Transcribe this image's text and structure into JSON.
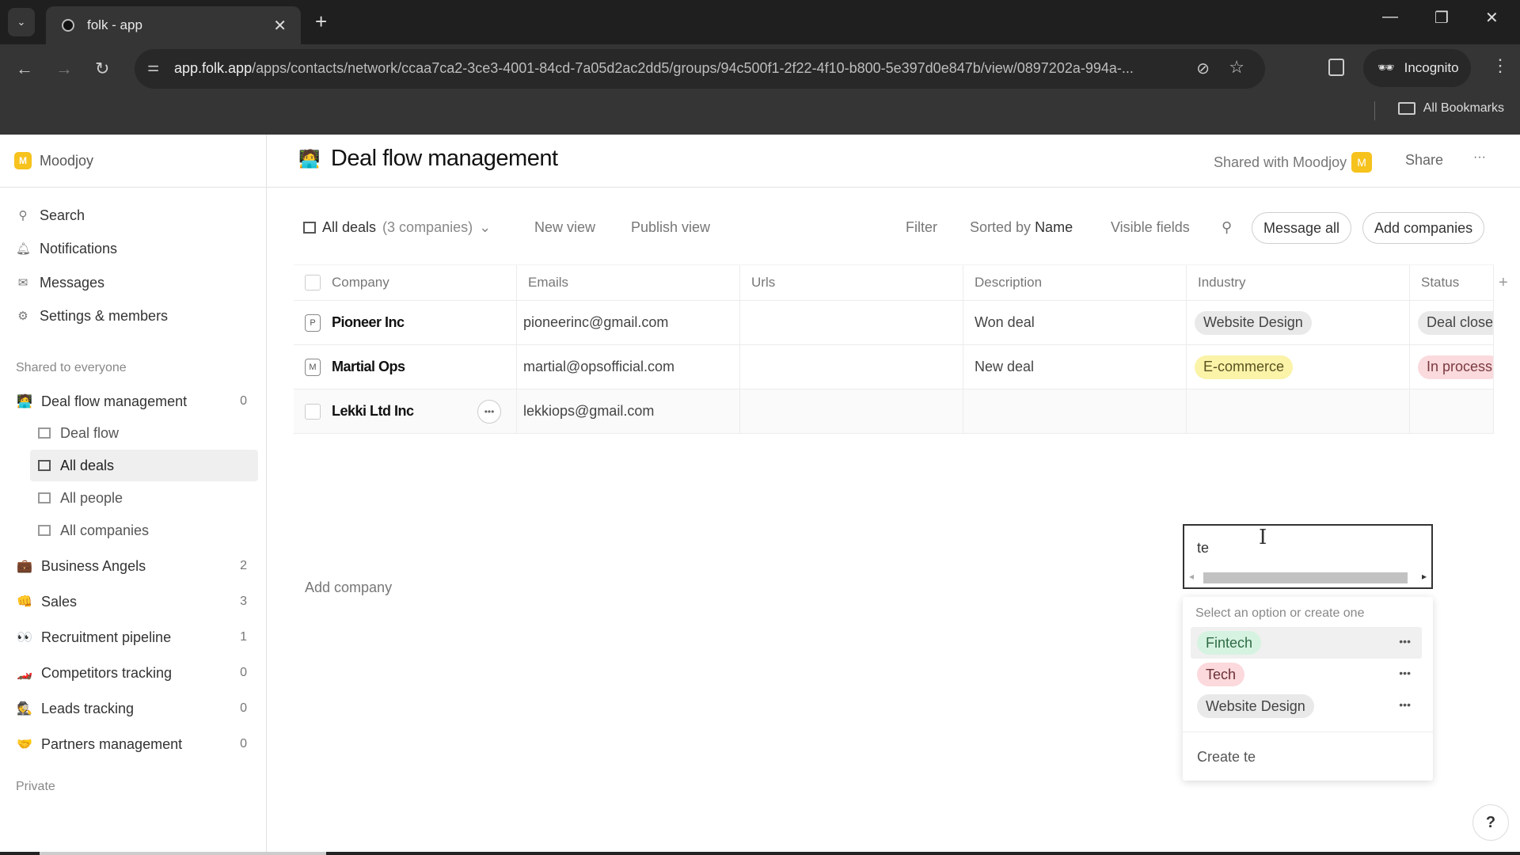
{
  "browser": {
    "tab_title": "folk - app",
    "url_host": "app.folk.app",
    "url_path": "/apps/contacts/network/ccaa7ca2-3ce3-4001-84cd-7a05d2ac2dd5/groups/94c500f1-2f22-4f10-b800-5e397d0e847b/view/0897202a-994a-...",
    "incognito_label": "Incognito",
    "bookmarks_label": "All Bookmarks"
  },
  "sidebar": {
    "workspace_initial": "M",
    "workspace_name": "Moodjoy",
    "nav": [
      {
        "icon": "search-icon",
        "label": "Search"
      },
      {
        "icon": "bell-icon",
        "label": "Notifications"
      },
      {
        "icon": "mail-icon",
        "label": "Messages"
      },
      {
        "icon": "gear-icon",
        "label": "Settings & members"
      }
    ],
    "shared_label": "Shared to everyone",
    "groups": [
      {
        "emoji": "🧑‍💻",
        "label": "Deal flow management",
        "count": "0"
      },
      {
        "emoji": "💼",
        "label": "Business Angels",
        "count": "2"
      },
      {
        "emoji": "👊",
        "label": "Sales",
        "count": "3"
      },
      {
        "emoji": "👀",
        "label": "Recruitment pipeline",
        "count": "1"
      },
      {
        "emoji": "🏎️",
        "label": "Competitors tracking",
        "count": "0"
      },
      {
        "emoji": "🕵️",
        "label": "Leads tracking",
        "count": "0"
      },
      {
        "emoji": "🤝",
        "label": "Partners management",
        "count": "0"
      }
    ],
    "views": [
      {
        "label": "Deal flow",
        "active": false
      },
      {
        "label": "All deals",
        "active": true
      },
      {
        "label": "All people",
        "active": false
      },
      {
        "label": "All companies",
        "active": false
      }
    ],
    "private_label": "Private"
  },
  "header": {
    "emoji": "🧑‍💻",
    "title": "Deal flow management",
    "shared_with": "Shared with Moodjoy",
    "avatar_initial": "M",
    "share_label": "Share",
    "more_label": "···"
  },
  "toolbar": {
    "view_name": "All deals",
    "view_count": "(3 companies)",
    "new_view": "New view",
    "publish_view": "Publish view",
    "filter": "Filter",
    "sorted_prefix": "Sorted by",
    "sorted_field": "Name",
    "visible_fields": "Visible fields",
    "message_all": "Message all",
    "add_companies": "Add companies"
  },
  "table": {
    "columns": [
      "Company",
      "Emails",
      "Urls",
      "Description",
      "Industry",
      "Status"
    ],
    "rows": [
      {
        "initial": "P",
        "company": "Pioneer Inc",
        "email": "pioneerinc@gmail.com",
        "url": "",
        "description": "Won deal",
        "industry": "Website Design",
        "industry_color": "#e9e9e9",
        "status": "Deal closed",
        "status_color": "#e9e9e9"
      },
      {
        "initial": "M",
        "company": "Martial Ops",
        "email": "martial@opsofficial.com",
        "url": "",
        "description": "New deal",
        "industry": "E-commerce",
        "industry_color": "#faf3a8",
        "status": "In process",
        "status_color": "#fadadd"
      },
      {
        "initial": "",
        "company": "Lekki Ltd Inc",
        "email": "lekkiops@gmail.com",
        "url": "",
        "description": "",
        "industry": "",
        "status": ""
      }
    ],
    "add_company": "Add company"
  },
  "editor": {
    "value": "te",
    "hint": "Select an option or create one",
    "options": [
      {
        "label": "Fintech",
        "color": "#d6f3e1",
        "text_color": "#2f6b45"
      },
      {
        "label": "Tech",
        "color": "#fbd9dc",
        "text_color": "#6b2f35"
      },
      {
        "label": "Website Design",
        "color": "#e9e9e9",
        "text_color": "#444"
      }
    ],
    "create_label": "Create te"
  },
  "help_label": "?"
}
